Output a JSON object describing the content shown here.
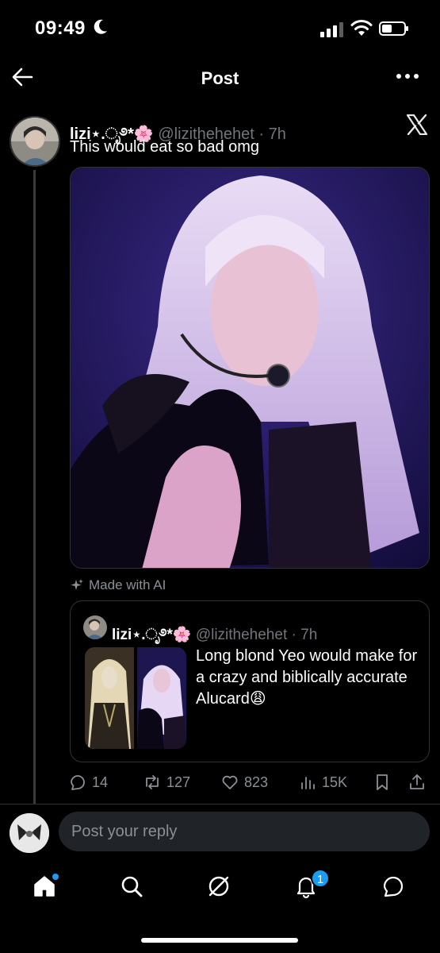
{
  "status_bar": {
    "time": "09:49",
    "icons": [
      "moon-icon",
      "signal-icon",
      "wifi-icon",
      "battery-icon"
    ]
  },
  "header": {
    "title": "Post",
    "back_icon": "arrow-left-icon",
    "more_icon": "more-dots-icon"
  },
  "post": {
    "author_name": "lizi⋆.ೃ࿔*🌸",
    "author_handle": "@lizithehehet",
    "time": "7h",
    "text": "This would eat so bad omg",
    "platform_icon": "x-logo-icon",
    "ai_label": "Made with AI"
  },
  "quote": {
    "author_name": "lizi⋆.ೃ࿔*🌸",
    "author_handle": "@lizithehehet",
    "time": "7h",
    "text": "Long blond Yeo would make for a crazy and biblically accurate Alucard😩"
  },
  "actions": {
    "replies": "14",
    "reposts": "127",
    "likes": "823",
    "views": "15K",
    "icons": [
      "reply-icon",
      "repost-icon",
      "heart-icon",
      "views-icon",
      "bookmark-icon",
      "share-icon"
    ]
  },
  "reply": {
    "placeholder": "Post your reply"
  },
  "tabbar": {
    "tabs": [
      "home",
      "search",
      "grok",
      "notifications",
      "messages"
    ],
    "notifications_count": "1"
  },
  "colors": {
    "background": "#000000",
    "text": "#e7e9ea",
    "muted": "#71767b",
    "accent": "#1d9bf0",
    "border": "#2f3336"
  }
}
